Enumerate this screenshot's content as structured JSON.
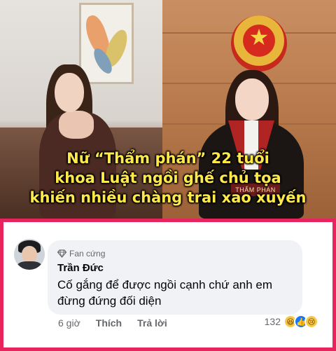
{
  "post_image": {
    "caption_lines": [
      "Nữ “Thẩm phán” 22 tuổi",
      "khoa Luật ngồi ghế chủ tọa",
      "khiến nhiều chàng trai xao xuyến"
    ],
    "nameplate": "THẨM PHÁN",
    "caption_color": "#ffe94a"
  },
  "comment": {
    "badge_label": "Fan cứng",
    "badge_icon": "diamond-icon",
    "author": "Trần Đức",
    "text": "Cố gắng để được ngồi cạnh chứ anh em đừng đứng đối diện",
    "time": "6 giờ",
    "like_label": "Thích",
    "reply_label": "Trả lời",
    "reaction_count": "132",
    "reaction_icons": [
      "haha-icon",
      "like-icon",
      "sad-icon"
    ],
    "border_color": "#e8245e"
  }
}
